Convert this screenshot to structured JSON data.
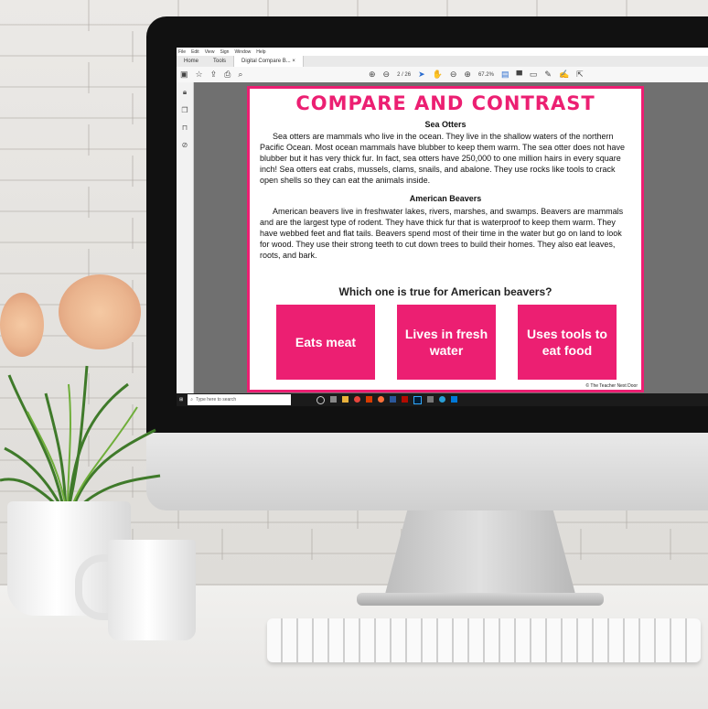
{
  "app": {
    "menu": [
      "File",
      "Edit",
      "View",
      "Sign",
      "Window",
      "Help"
    ],
    "tabs": [
      "Home",
      "Tools",
      "Digital Compare B... ×"
    ],
    "page_indicator": "2 / 26",
    "zoom": "67.2%"
  },
  "document": {
    "title": "COMPARE AND CONTRAST",
    "section1_heading": "Sea Otters",
    "section1_text": "Sea otters are mammals who live in the ocean. They live in the shallow waters of the northern Pacific Ocean. Most ocean mammals have blubber to keep them warm. The sea otter does not have blubber but it has very thick fur. In fact, sea otters have 250,000 to one million hairs in every square inch! Sea otters eat crabs, mussels, clams, snails, and abalone. They use rocks like tools to crack open shells so they can eat the animals inside.",
    "section2_heading": "American Beavers",
    "section2_text": "American beavers live in freshwater lakes, rivers, marshes, and swamps. Beavers are mammals and are the largest type of rodent. They have thick fur that is waterproof to keep them warm. They have webbed feet and flat tails. Beavers spend most of their time in the water but go on land to look for wood. They use their strong teeth to cut down trees to build their homes. They also eat leaves, roots, and bark.",
    "question": "Which one is true for American beavers?",
    "answers": [
      "Eats meat",
      "Lives in fresh water",
      "Uses tools to eat food"
    ],
    "copyright": "© The Teacher Next Door"
  },
  "taskbar": {
    "search_placeholder": "Type here to search"
  },
  "colors": {
    "accent": "#ec1f72"
  }
}
